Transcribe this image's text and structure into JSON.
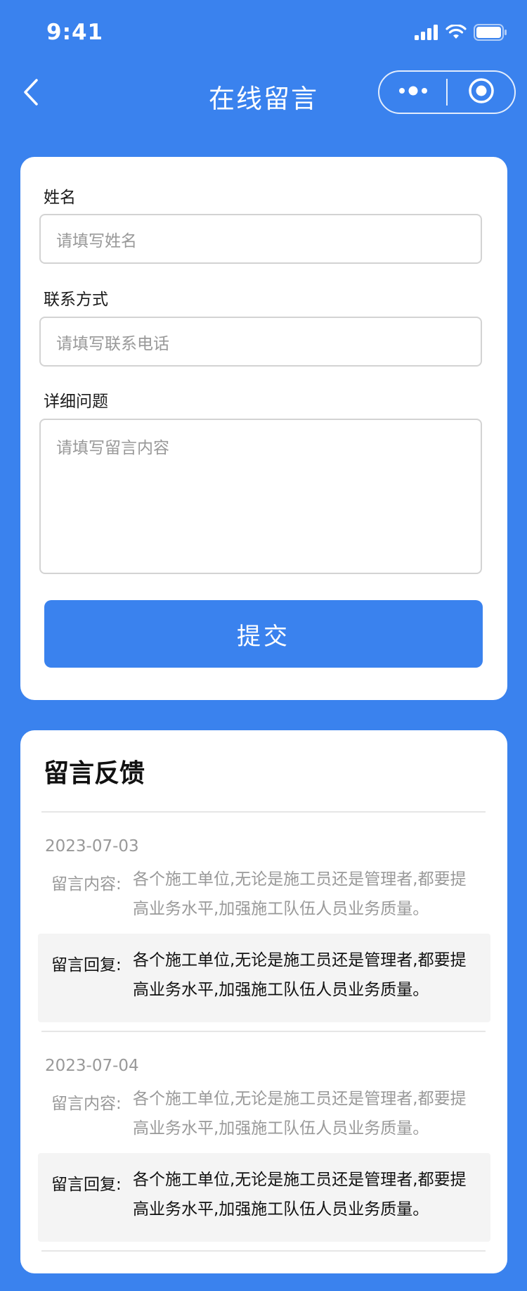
{
  "status_bar": {
    "time": "9:41"
  },
  "nav": {
    "title": "在线留言"
  },
  "form": {
    "name_label": "姓名",
    "name_placeholder": "请填写姓名",
    "contact_label": "联系方式",
    "contact_placeholder": "请填写联系电话",
    "detail_label": "详细问题",
    "detail_placeholder": "请填写留言内容",
    "submit_label": "提交"
  },
  "feedback": {
    "title": "留言反馈",
    "entries": [
      {
        "date": "2023-07-03",
        "content_label": "留言内容:",
        "content_line1": "各个施工单位,无论是施工员还是管理者,都要提",
        "content_line2": "高业务水平,加强施工队伍人员业务质量。",
        "reply_label": "留言回复:",
        "reply_line1": "各个施工单位,无论是施工员还是管理者,都要提",
        "reply_line2": "高业务水平,加强施工队伍人员业务质量。"
      },
      {
        "date": "2023-07-04",
        "content_label": "留言内容:",
        "content_line1": "各个施工单位,无论是施工员还是管理者,都要提",
        "content_line2": "高业务水平,加强施工队伍人员业务质量。",
        "reply_label": "留言回复:",
        "reply_line1": "各个施工单位,无论是施工员还是管理者,都要提",
        "reply_line2": "高业务水平,加强施工队伍人员业务质量。"
      }
    ]
  },
  "colors": {
    "primary": "#3a82ee",
    "card": "#ffffff",
    "muted_text": "#999999",
    "reply_bg": "#f4f4f4"
  },
  "icons": [
    "signal-icon",
    "wifi-icon",
    "battery-icon",
    "back-arrow-icon",
    "more-dots-icon",
    "close-target-icon"
  ]
}
